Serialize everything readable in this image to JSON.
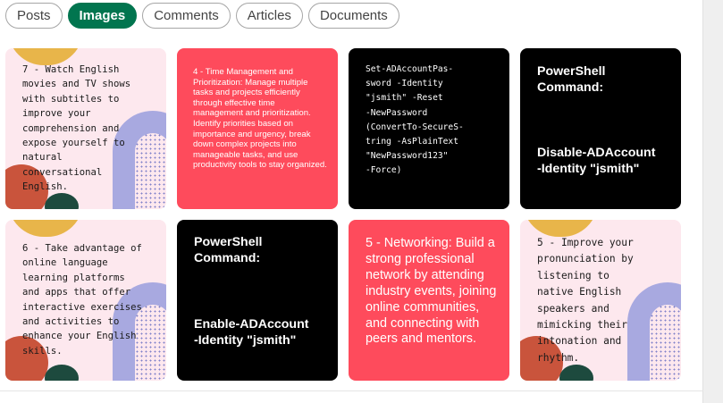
{
  "filters": [
    {
      "label": "Posts",
      "active": false
    },
    {
      "label": "Images",
      "active": true
    },
    {
      "label": "Comments",
      "active": false
    },
    {
      "label": "Articles",
      "active": false
    },
    {
      "label": "Documents",
      "active": false
    }
  ],
  "cards": {
    "c1": {
      "text": "7 - Watch English\nmovies and TV shows\nwith subtitles to\nimprove your\ncomprehension and\nexpose yourself to\nnatural\nconversational\nEnglish."
    },
    "c2": {
      "text": "4 - Time Management and Prioritization: Manage multiple tasks and projects efficiently through effective time management and prioritization. Identify priorities based on importance and urgency, break down complex projects into manageable tasks, and use productivity tools to stay organized."
    },
    "c3": {
      "text": "Set-ADAccountPas-\nsword -Identity\n\"jsmith\" -Reset\n-NewPassword\n(ConvertTo-SecureS-\ntring -AsPlainText\n\"NewPassword123\"\n-Force)"
    },
    "c4": {
      "title": "PowerShell\nCommand:",
      "command": "Disable-ADAccount\n-Identity \"jsmith\""
    },
    "c5": {
      "text": "6 - Take advantage of\nonline language\nlearning platforms\nand apps that offer\ninteractive exercises\nand activities to\nenhance your English\nskills."
    },
    "c6": {
      "title": "PowerShell\nCommand:",
      "command": "Enable-ADAccount\n-Identity \"jsmith\""
    },
    "c7": {
      "text": "5 - Networking: Build a strong professional network by attending industry events, joining online communities, and connecting with peers and mentors."
    },
    "c8": {
      "text": "5 - Improve your\npronunciation by\nlistening to\nnative English\nspeakers and\nmimicking their\nintonation and\nrhythm."
    }
  },
  "colors": {
    "active_chip": "#01754f",
    "red_card": "#fe4b5c",
    "pink_card": "#fde8ee",
    "black_card": "#000000"
  }
}
